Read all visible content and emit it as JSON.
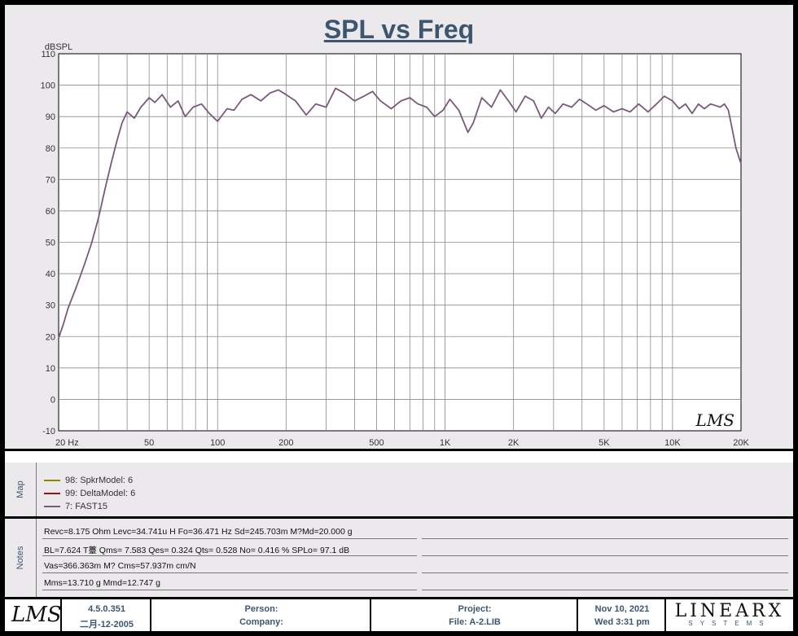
{
  "chart_data": {
    "type": "line",
    "title": "SPL vs Freq",
    "ylabel": "dBSPL",
    "xlabel": "",
    "xscale": "log",
    "xlim": [
      20,
      20000
    ],
    "ylim": [
      -10,
      110
    ],
    "yticks": [
      110,
      100,
      90,
      80,
      70,
      60,
      50,
      40,
      30,
      20,
      10,
      0,
      -10
    ],
    "xticks": [
      {
        "v": 20,
        "label": "20  Hz"
      },
      {
        "v": 50,
        "label": "50"
      },
      {
        "v": 100,
        "label": "100"
      },
      {
        "v": 200,
        "label": "200"
      },
      {
        "v": 500,
        "label": "500"
      },
      {
        "v": 1000,
        "label": "1K"
      },
      {
        "v": 2000,
        "label": "2K"
      },
      {
        "v": 5000,
        "label": "5K"
      },
      {
        "v": 10000,
        "label": "10K"
      },
      {
        "v": 20000,
        "label": "20K"
      }
    ],
    "grid": true,
    "line_color": "#7a5a7a",
    "series": [
      {
        "name": "7:  FAST15",
        "x": [
          20,
          21,
          22,
          24,
          26,
          28,
          30,
          32,
          34,
          36,
          38,
          40,
          43,
          46,
          50,
          53,
          57,
          62,
          67,
          72,
          78,
          85,
          92,
          100,
          110,
          118,
          128,
          140,
          155,
          170,
          185,
          200,
          220,
          245,
          270,
          300,
          330,
          360,
          400,
          440,
          480,
          520,
          580,
          640,
          700,
          760,
          830,
          900,
          980,
          1050,
          1150,
          1260,
          1330,
          1450,
          1600,
          1750,
          1900,
          2050,
          2250,
          2450,
          2650,
          2850,
          3050,
          3300,
          3600,
          3900,
          4200,
          4600,
          5000,
          5500,
          6000,
          6500,
          7100,
          7800,
          8500,
          9200,
          10000,
          10700,
          11400,
          12200,
          13000,
          13800,
          14700,
          15500,
          16200,
          16900,
          17600,
          18300,
          19000,
          19600,
          20000
        ],
        "y": [
          19.5,
          24,
          29,
          36,
          43,
          50,
          58,
          67,
          75,
          82,
          88,
          91.5,
          89.5,
          93,
          96,
          94.5,
          97,
          93,
          95,
          90,
          93,
          94,
          91,
          88.5,
          92.5,
          92,
          95.5,
          97,
          95,
          97.5,
          98.5,
          97,
          95,
          90.5,
          94,
          93,
          99,
          97.5,
          95,
          96.5,
          98,
          95,
          92.5,
          95,
          96,
          94,
          93,
          90,
          92,
          95.5,
          92,
          85,
          88,
          96,
          93,
          98.5,
          95,
          91.5,
          96.5,
          95,
          89.5,
          93,
          91,
          94,
          93,
          95.5,
          94,
          92,
          93.5,
          91.5,
          92.5,
          91.5,
          94,
          91.5,
          94,
          96.5,
          95,
          92.5,
          94,
          91,
          94,
          92.5,
          94,
          93.5,
          93,
          94,
          92,
          86,
          80,
          77,
          75
        ]
      }
    ]
  },
  "legend": [
    {
      "label": "98:  SpkrModel: 6",
      "color": "#8a8a00"
    },
    {
      "label": "99:  DeltaModel: 6",
      "color": "#8a1a1a"
    },
    {
      "label": "7:  FAST15",
      "color": "#7a5a7a"
    }
  ],
  "panels": {
    "map": "Map",
    "notes": "Notes"
  },
  "notes": [
    "Revc=8.175 Ohm  Levc=34.741u H  Fo=36.471 Hz  Sd=245.703m M?Md=20.000 g",
    "BL=7.624 T薹  Qms= 7.583  Qes= 0.324  Qts= 0.528  No= 0.416 %  SPLo= 97.1 dB",
    "Vas=366.363m M? Cms=57.937m cm/N",
    "Mms=13.710 g  Mmd=12.747 g"
  ],
  "watermark": "LMS",
  "footer": {
    "logo": "LMS",
    "version": "4.5.0.351",
    "version_date": "二月-12-2005",
    "person_label": "Person:",
    "company_label": "Company:",
    "project_label": "Project:",
    "file_label": "File: A-2.LIB",
    "date": "Nov 10, 2021",
    "time": "Wed  3:31 pm",
    "brand": "LINEARX",
    "brand_sub": "SYSTEMS"
  }
}
